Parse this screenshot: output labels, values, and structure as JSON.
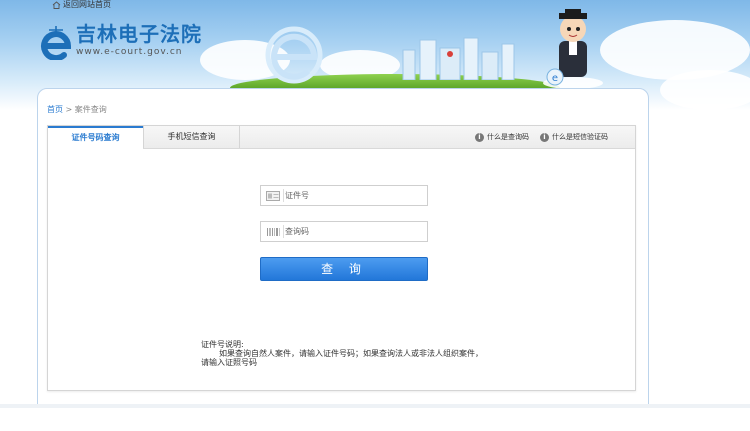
{
  "header": {
    "back_link": "返回网站首页",
    "logo_title": "吉林电子法院",
    "logo_url": "www.e-court.gov.cn"
  },
  "breadcrumb": {
    "home": "首页",
    "separator": " > ",
    "current": "案件查询"
  },
  "tabs": [
    {
      "label": "证件号码查询",
      "active": true
    },
    {
      "label": "手机短信查询",
      "active": false
    }
  ],
  "help_links": [
    {
      "label": "什么是查询码"
    },
    {
      "label": "什么是短信验证码"
    }
  ],
  "form": {
    "id_field": {
      "placeholder": "证件号",
      "value": ""
    },
    "query_code_field": {
      "placeholder": "查询码",
      "value": ""
    },
    "submit_label": "查 询"
  },
  "notes": {
    "title": "证件号说明:",
    "line1": "如果查询自然人案件，请输入证件号码；如果查询法人或非法人组织案件，",
    "line2": "请输入证照号码"
  },
  "colors": {
    "accent": "#2a7bd0",
    "button": "#2f84e2"
  }
}
